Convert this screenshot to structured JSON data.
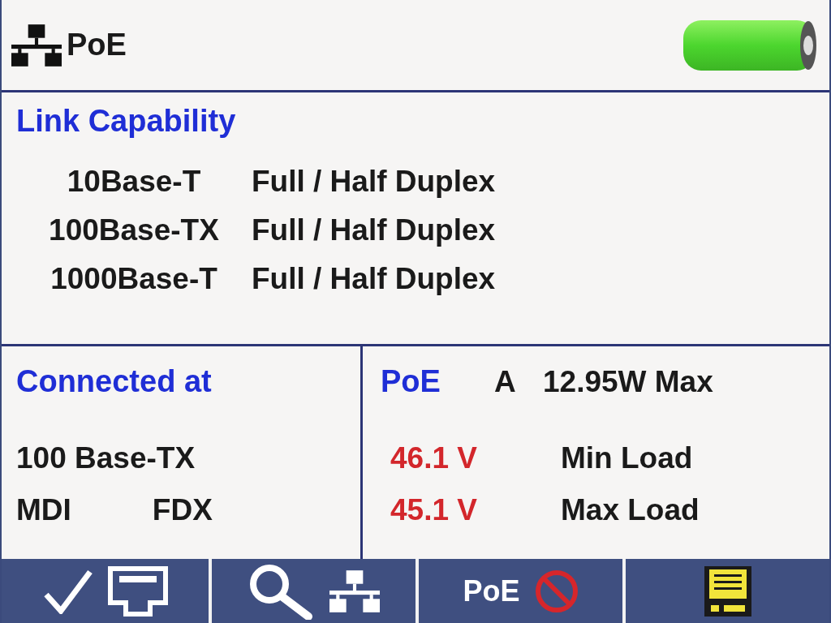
{
  "header": {
    "title": "PoE"
  },
  "link_capability": {
    "title": "Link Capability",
    "rows": [
      {
        "speed": "10Base-T",
        "duplex": "Full / Half Duplex"
      },
      {
        "speed": "100Base-TX",
        "duplex": "Full / Half Duplex"
      },
      {
        "speed": "1000Base-T",
        "duplex": "Full / Half Duplex"
      }
    ]
  },
  "connection": {
    "title": "Connected at",
    "speed": "100 Base-TX",
    "mdi": "MDI",
    "duplex": "FDX"
  },
  "poe": {
    "title": "PoE",
    "pair": "A",
    "power": "12.95W Max",
    "readings": [
      {
        "voltage": "46.1 V",
        "load": "Min Load"
      },
      {
        "voltage": "45.1 V",
        "load": "Max Load"
      }
    ]
  },
  "softkeys": [
    {
      "kind": "link-check"
    },
    {
      "kind": "discover"
    },
    {
      "kind": "poe-off",
      "label": "PoE"
    },
    {
      "kind": "save"
    }
  ]
}
